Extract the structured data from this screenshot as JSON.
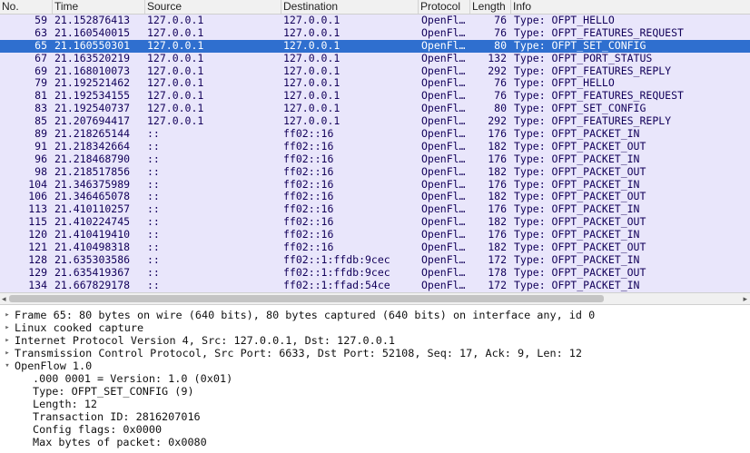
{
  "columns": {
    "no": "No.",
    "time": "Time",
    "source": "Source",
    "destination": "Destination",
    "protocol": "Protocol",
    "length": "Length",
    "info": "Info"
  },
  "packets": [
    {
      "no": "59",
      "time": "21.152876413",
      "source": "127.0.0.1",
      "destination": "127.0.0.1",
      "protocol": "OpenFl…",
      "length": "76",
      "info": "Type: OFPT_HELLO",
      "selected": false
    },
    {
      "no": "63",
      "time": "21.160540015",
      "source": "127.0.0.1",
      "destination": "127.0.0.1",
      "protocol": "OpenFl…",
      "length": "76",
      "info": "Type: OFPT_FEATURES_REQUEST",
      "selected": false
    },
    {
      "no": "65",
      "time": "21.160550301",
      "source": "127.0.0.1",
      "destination": "127.0.0.1",
      "protocol": "OpenFl…",
      "length": "80",
      "info": "Type: OFPT_SET_CONFIG",
      "selected": true
    },
    {
      "no": "67",
      "time": "21.163520219",
      "source": "127.0.0.1",
      "destination": "127.0.0.1",
      "protocol": "OpenFl…",
      "length": "132",
      "info": "Type: OFPT_PORT_STATUS",
      "selected": false
    },
    {
      "no": "69",
      "time": "21.168010073",
      "source": "127.0.0.1",
      "destination": "127.0.0.1",
      "protocol": "OpenFl…",
      "length": "292",
      "info": "Type: OFPT_FEATURES_REPLY",
      "selected": false
    },
    {
      "no": "79",
      "time": "21.192521462",
      "source": "127.0.0.1",
      "destination": "127.0.0.1",
      "protocol": "OpenFl…",
      "length": "76",
      "info": "Type: OFPT_HELLO",
      "selected": false
    },
    {
      "no": "81",
      "time": "21.192534155",
      "source": "127.0.0.1",
      "destination": "127.0.0.1",
      "protocol": "OpenFl…",
      "length": "76",
      "info": "Type: OFPT_FEATURES_REQUEST",
      "selected": false
    },
    {
      "no": "83",
      "time": "21.192540737",
      "source": "127.0.0.1",
      "destination": "127.0.0.1",
      "protocol": "OpenFl…",
      "length": "80",
      "info": "Type: OFPT_SET_CONFIG",
      "selected": false
    },
    {
      "no": "85",
      "time": "21.207694417",
      "source": "127.0.0.1",
      "destination": "127.0.0.1",
      "protocol": "OpenFl…",
      "length": "292",
      "info": "Type: OFPT_FEATURES_REPLY",
      "selected": false
    },
    {
      "no": "89",
      "time": "21.218265144",
      "source": "::",
      "destination": "ff02::16",
      "protocol": "OpenFl…",
      "length": "176",
      "info": "Type: OFPT_PACKET_IN",
      "selected": false
    },
    {
      "no": "91",
      "time": "21.218342664",
      "source": "::",
      "destination": "ff02::16",
      "protocol": "OpenFl…",
      "length": "182",
      "info": "Type: OFPT_PACKET_OUT",
      "selected": false
    },
    {
      "no": "96",
      "time": "21.218468790",
      "source": "::",
      "destination": "ff02::16",
      "protocol": "OpenFl…",
      "length": "176",
      "info": "Type: OFPT_PACKET_IN",
      "selected": false
    },
    {
      "no": "98",
      "time": "21.218517856",
      "source": "::",
      "destination": "ff02::16",
      "protocol": "OpenFl…",
      "length": "182",
      "info": "Type: OFPT_PACKET_OUT",
      "selected": false
    },
    {
      "no": "104",
      "time": "21.346375989",
      "source": "::",
      "destination": "ff02::16",
      "protocol": "OpenFl…",
      "length": "176",
      "info": "Type: OFPT_PACKET_IN",
      "selected": false
    },
    {
      "no": "106",
      "time": "21.346465078",
      "source": "::",
      "destination": "ff02::16",
      "protocol": "OpenFl…",
      "length": "182",
      "info": "Type: OFPT_PACKET_OUT",
      "selected": false
    },
    {
      "no": "113",
      "time": "21.410110257",
      "source": "::",
      "destination": "ff02::16",
      "protocol": "OpenFl…",
      "length": "176",
      "info": "Type: OFPT_PACKET_IN",
      "selected": false
    },
    {
      "no": "115",
      "time": "21.410224745",
      "source": "::",
      "destination": "ff02::16",
      "protocol": "OpenFl…",
      "length": "182",
      "info": "Type: OFPT_PACKET_OUT",
      "selected": false
    },
    {
      "no": "120",
      "time": "21.410419410",
      "source": "::",
      "destination": "ff02::16",
      "protocol": "OpenFl…",
      "length": "176",
      "info": "Type: OFPT_PACKET_IN",
      "selected": false
    },
    {
      "no": "121",
      "time": "21.410498318",
      "source": "::",
      "destination": "ff02::16",
      "protocol": "OpenFl…",
      "length": "182",
      "info": "Type: OFPT_PACKET_OUT",
      "selected": false
    },
    {
      "no": "128",
      "time": "21.635303586",
      "source": "::",
      "destination": "ff02::1:ffdb:9cec",
      "protocol": "OpenFl…",
      "length": "172",
      "info": "Type: OFPT_PACKET_IN",
      "selected": false
    },
    {
      "no": "129",
      "time": "21.635419367",
      "source": "::",
      "destination": "ff02::1:ffdb:9cec",
      "protocol": "OpenFl…",
      "length": "178",
      "info": "Type: OFPT_PACKET_OUT",
      "selected": false
    },
    {
      "no": "134",
      "time": "21.667829178",
      "source": "::",
      "destination": "ff02::1:ffad:54ce",
      "protocol": "OpenFl…",
      "length": "172",
      "info": "Type: OFPT_PACKET_IN",
      "selected": false
    }
  ],
  "details": [
    {
      "text": "Frame 65: 80 bytes on wire (640 bits), 80 bytes captured (640 bits) on interface any, id 0",
      "expanded": false,
      "sub": false
    },
    {
      "text": "Linux cooked capture",
      "expanded": false,
      "sub": false
    },
    {
      "text": "Internet Protocol Version 4, Src: 127.0.0.1, Dst: 127.0.0.1",
      "expanded": false,
      "sub": false
    },
    {
      "text": "Transmission Control Protocol, Src Port: 6633, Dst Port: 52108, Seq: 17, Ack: 9, Len: 12",
      "expanded": false,
      "sub": false
    },
    {
      "text": "OpenFlow 1.0",
      "expanded": true,
      "sub": false
    },
    {
      "text": ".000 0001 = Version: 1.0 (0x01)",
      "sub": true
    },
    {
      "text": "Type: OFPT_SET_CONFIG (9)",
      "sub": true
    },
    {
      "text": "Length: 12",
      "sub": true
    },
    {
      "text": "Transaction ID: 2816207016",
      "sub": true
    },
    {
      "text": "Config flags: 0x0000",
      "sub": true
    },
    {
      "text": "Max bytes of packet: 0x0080",
      "sub": true
    }
  ],
  "icons": {
    "collapsed": "▸",
    "expanded": "▾",
    "scroll_left": "◂",
    "scroll_right": "▸"
  },
  "colors": {
    "row_bg": "#e9e6fb",
    "selected_bg": "#2f6fcf"
  }
}
